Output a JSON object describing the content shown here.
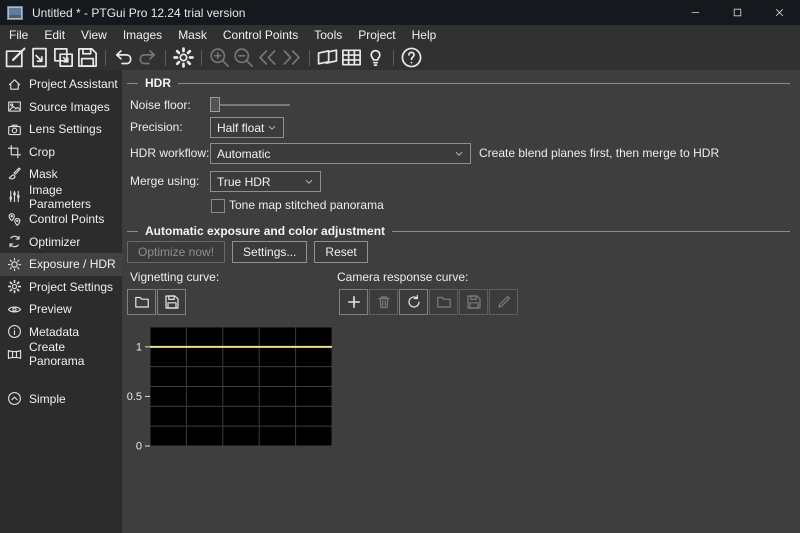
{
  "window": {
    "title": "Untitled * - PTGui Pro 12.24 trial version",
    "controls": [
      "minimize",
      "maximize",
      "close"
    ]
  },
  "menu": {
    "items": [
      "File",
      "Edit",
      "View",
      "Images",
      "Mask",
      "Control Points",
      "Tools",
      "Project",
      "Help"
    ]
  },
  "toolbar": {
    "buttons": [
      {
        "name": "new-project-button",
        "icon": "edit-square-icon",
        "enabled": true
      },
      {
        "sep": true,
        "hidden": true
      },
      {
        "name": "open-project-button",
        "icon": "open-doc-icon",
        "enabled": true
      },
      {
        "name": "duplicate-project-button",
        "icon": "copy-icon",
        "enabled": true
      },
      {
        "name": "save-project-button",
        "icon": "floppy-icon",
        "enabled": true
      },
      {
        "sep": true
      },
      {
        "name": "undo-button",
        "icon": "undo-icon",
        "enabled": true
      },
      {
        "name": "redo-button",
        "icon": "redo-icon",
        "enabled": false
      },
      {
        "sep": true
      },
      {
        "name": "settings-gear-button",
        "icon": "gear-icon",
        "enabled": true
      },
      {
        "sep": true
      },
      {
        "name": "zoom-in-button",
        "icon": "zoom-in-icon",
        "enabled": false
      },
      {
        "name": "zoom-out-button",
        "icon": "zoom-out-icon",
        "enabled": false
      },
      {
        "name": "previous-image-button",
        "icon": "rewind-icon",
        "enabled": false
      },
      {
        "name": "next-image-button",
        "icon": "fast-forward-icon",
        "enabled": false
      },
      {
        "sep": true
      },
      {
        "name": "panorama-editor-button",
        "icon": "frames-icon",
        "enabled": true
      },
      {
        "name": "detail-viewer-button",
        "icon": "grid-icon",
        "enabled": true
      },
      {
        "name": "assistant-hint-button",
        "icon": "lightbulb-icon",
        "enabled": true
      },
      {
        "sep": true
      },
      {
        "name": "help-button",
        "icon": "help-circle-icon",
        "enabled": true
      }
    ]
  },
  "sidebar": {
    "items": [
      {
        "label": "Project Assistant",
        "icon": "home-icon",
        "selected": false
      },
      {
        "label": "Source Images",
        "icon": "image-icon",
        "selected": false
      },
      {
        "label": "Lens Settings",
        "icon": "camera-icon",
        "selected": false
      },
      {
        "label": "Crop",
        "icon": "crop-icon",
        "selected": false
      },
      {
        "label": "Mask",
        "icon": "brush-icon",
        "selected": false
      },
      {
        "label": "Image Parameters",
        "icon": "sliders-icon",
        "selected": false
      },
      {
        "label": "Control Points",
        "icon": "map-pins-icon",
        "selected": false
      },
      {
        "label": "Optimizer",
        "icon": "optimizer-arrows-icon",
        "selected": false
      },
      {
        "label": "Exposure / HDR",
        "icon": "sun-icon",
        "selected": true
      },
      {
        "label": "Project Settings",
        "icon": "gear-icon",
        "selected": false
      },
      {
        "label": "Preview",
        "icon": "eye-icon",
        "selected": false
      },
      {
        "label": "Metadata",
        "icon": "info-icon",
        "selected": false
      },
      {
        "label": "Create Panorama",
        "icon": "panorama-icon",
        "selected": false
      }
    ],
    "simple": {
      "label": "Simple",
      "icon": "chevron-up-circle-icon"
    }
  },
  "main": {
    "hdr": {
      "group_title": "HDR",
      "noise_floor_label": "Noise floor:",
      "precision_label": "Precision:",
      "precision_value": "Half float",
      "hdr_workflow_label": "HDR workflow:",
      "hdr_workflow_value": "Automatic",
      "hdr_workflow_note": "Create blend planes first, then merge to HDR",
      "merge_using_label": "Merge using:",
      "merge_using_value": "True HDR",
      "tone_map_label": "Tone map stitched panorama",
      "tone_map_checked": false
    },
    "auto_exposure": {
      "group_title": "Automatic exposure and color adjustment",
      "buttons": [
        {
          "label": "Optimize now!",
          "enabled": false
        },
        {
          "label": "Settings...",
          "enabled": true
        },
        {
          "label": "Reset",
          "enabled": true
        }
      ],
      "vignetting_label": "Vignetting curve:",
      "vignetting_buttons": [
        {
          "name": "vignetting-open-button",
          "icon": "folder-icon",
          "enabled": true
        },
        {
          "name": "vignetting-save-button",
          "icon": "floppy-icon",
          "enabled": true
        }
      ],
      "camera_response_label": "Camera response curve:",
      "camera_response_buttons": [
        {
          "name": "response-add-button",
          "icon": "plus-icon",
          "enabled": true
        },
        {
          "name": "response-delete-button",
          "icon": "trash-icon",
          "enabled": false
        },
        {
          "name": "response-reload-button",
          "icon": "reload-icon",
          "enabled": true
        },
        {
          "name": "response-open-button",
          "icon": "folder-icon",
          "enabled": false
        },
        {
          "name": "response-save-button",
          "icon": "floppy-icon",
          "enabled": false
        },
        {
          "name": "response-edit-button",
          "icon": "pencil-icon",
          "enabled": false
        }
      ]
    }
  },
  "chart_data": {
    "type": "line",
    "title": "Camera response curve",
    "xlabel": "",
    "ylabel": "",
    "xlim": [
      0,
      1
    ],
    "ylim": [
      0,
      1.2
    ],
    "x_grid_divisions": 5,
    "y_grid_step": 0.2,
    "yticks": [
      0,
      0.5,
      1
    ],
    "ytick_labels": [
      "0",
      "0.5",
      "1"
    ],
    "grid": true,
    "background": "#000000",
    "grid_color": "#3d3d3d",
    "legend": false,
    "series": [
      {
        "name": "response",
        "color": "#ebe28b",
        "points": [
          [
            0,
            1
          ],
          [
            1,
            1
          ]
        ]
      }
    ]
  }
}
